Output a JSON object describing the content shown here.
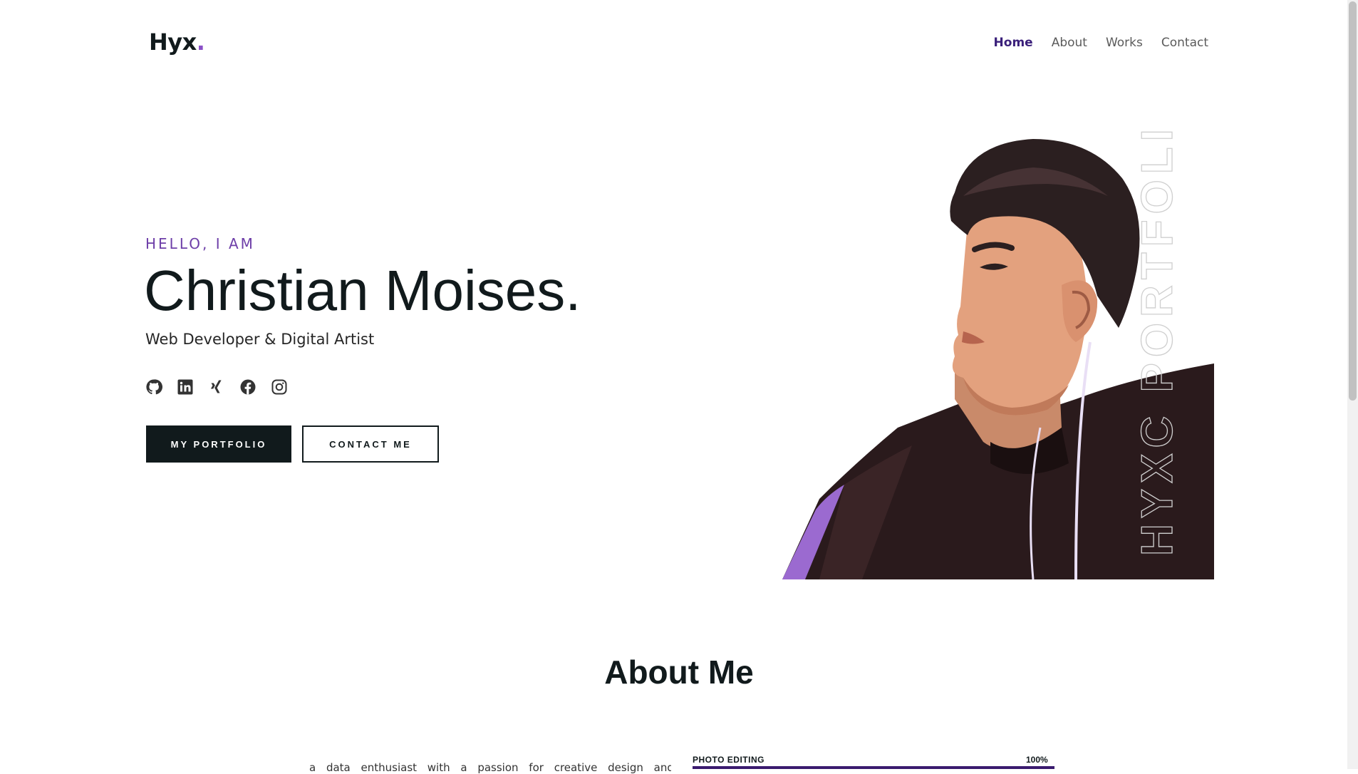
{
  "header": {
    "logo_text": "Hyx",
    "logo_dot": ".",
    "nav": [
      {
        "label": "Home",
        "active": true
      },
      {
        "label": "About",
        "active": false
      },
      {
        "label": "Works",
        "active": false
      },
      {
        "label": "Contact",
        "active": false
      }
    ]
  },
  "hero": {
    "kicker": "HELLO, I AM",
    "name": "Christian Moises.",
    "role": "Web Developer & Digital Artist",
    "socials": [
      "github-icon",
      "linkedin-icon",
      "xing-icon",
      "facebook-icon",
      "instagram-icon"
    ],
    "primary_button": "MY PORTFOLIO",
    "secondary_button": "CONTACT ME",
    "portrait_watermark": "HYXC PORTFOLIO"
  },
  "about": {
    "title": "About Me",
    "text_partial": "a data enthusiast with a passion for creative design and",
    "skills": [
      {
        "label": "PHOTO EDITING",
        "percent_label": "100%",
        "level": 1.0
      }
    ]
  },
  "colors": {
    "accent": "#6d3ea8",
    "dark": "#111a1c",
    "nav_active": "#3a1f7a",
    "skill_fill": "#3a1a6e"
  }
}
